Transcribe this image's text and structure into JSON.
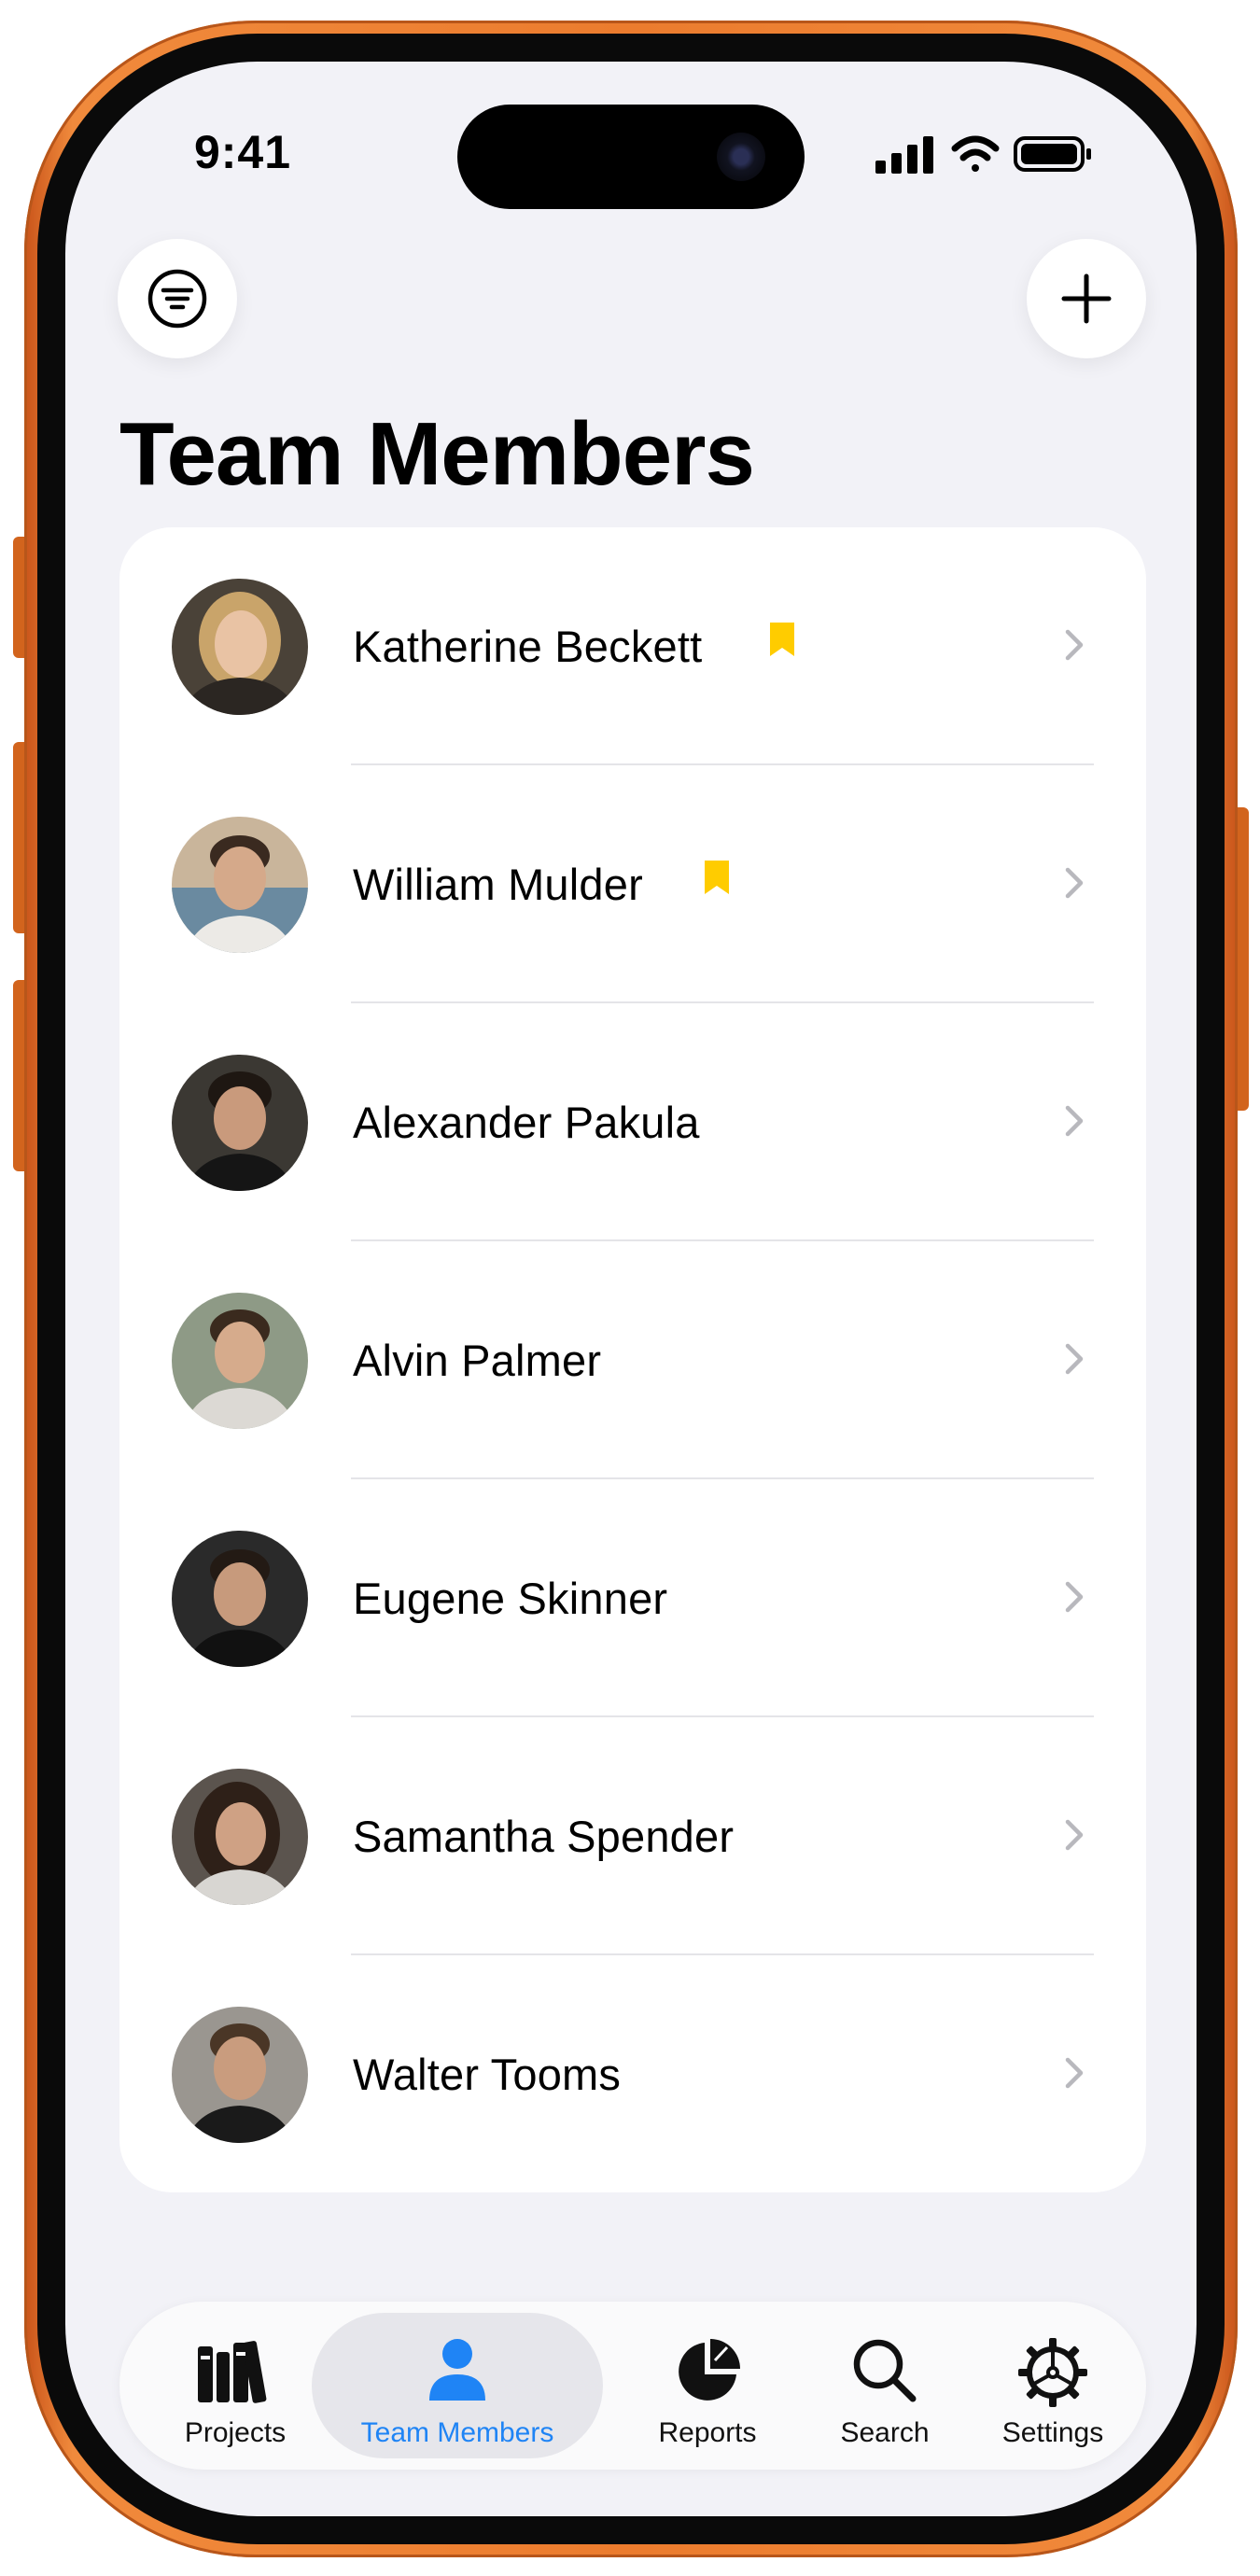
{
  "status_bar": {
    "time": "9:41"
  },
  "header": {
    "title": "Team Members"
  },
  "members": [
    {
      "name": "Katherine Beckett",
      "bookmarked": true
    },
    {
      "name": "William Mulder",
      "bookmarked": true
    },
    {
      "name": "Alexander Pakula",
      "bookmarked": false
    },
    {
      "name": "Alvin Palmer",
      "bookmarked": false
    },
    {
      "name": "Eugene Skinner",
      "bookmarked": false
    },
    {
      "name": "Samantha Spender",
      "bookmarked": false
    },
    {
      "name": "Walter Tooms",
      "bookmarked": false
    }
  ],
  "tabs": [
    {
      "label": "Projects",
      "icon": "books-icon",
      "active": false
    },
    {
      "label": "Team Members",
      "icon": "person-icon",
      "active": true
    },
    {
      "label": "Reports",
      "icon": "pie-chart-icon",
      "active": false
    },
    {
      "label": "Search",
      "icon": "magnifier-icon",
      "active": false
    },
    {
      "label": "Settings",
      "icon": "gear-icon",
      "active": false
    }
  ],
  "colors": {
    "accent": "#1f84f5",
    "bookmark": "#ffcc00",
    "frame": "#ec7c2e",
    "background": "#f2f2f7"
  }
}
